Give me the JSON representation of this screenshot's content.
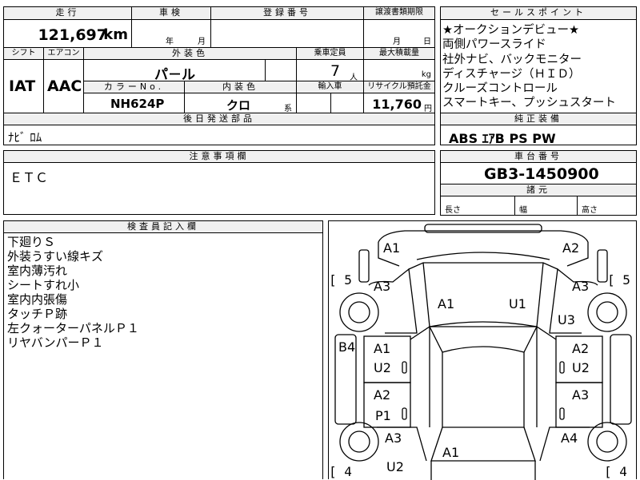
{
  "headers": {
    "mileage": "走行",
    "inspection": "車検",
    "registration_no": "登録番号",
    "transfer_deadline": "譲渡書類期限",
    "selling_points": "セールスポイント",
    "shift": "シフト",
    "aircon": "エアコン",
    "exterior_color": "外装色",
    "capacity": "乗車定員",
    "max_load": "最大積載量",
    "color_no": "カラーNo.",
    "interior_color": "内装色",
    "import": "輸入車",
    "recycle_fee": "リサイクル預託金",
    "later_parts": "後日発送部品",
    "standard_equipment": "純正装備",
    "notes": "注意事項欄",
    "chassis_no": "車台番号",
    "dimensions": "諸元",
    "inspector_notes": "検査員記入欄"
  },
  "mileage": {
    "value": "121,697",
    "unit": "km"
  },
  "inspection": {
    "year_unit": "年",
    "month_unit": "月"
  },
  "transfer_deadline": {
    "month_unit": "月",
    "day_unit": "日"
  },
  "selling_points": [
    "★オークションデビュー★",
    "両側パワースライド",
    "社外ナビ、バックモニター",
    "ディスチャージ（ＨＩＤ）",
    "クルーズコントロール",
    "スマートキー、プッシュスタート"
  ],
  "shift": "IAT",
  "aircon": "AAC",
  "exterior_color": "パ－ル",
  "capacity": {
    "value": "7",
    "unit": "人"
  },
  "max_load": {
    "unit": "kg"
  },
  "color_no": "NH624P",
  "interior_color": {
    "value": "クロ",
    "suffix": "系"
  },
  "recycle_fee": {
    "value": "11,760",
    "unit": "円"
  },
  "later_parts": "ﾅﾋﾞ ﾛﾑ",
  "standard_equipment": "ABS ｴｱB PS PW",
  "notes": "ＥＴＣ",
  "chassis_no": "GB3-1450900",
  "dimensions": {
    "length": "長さ",
    "width": "幅",
    "height": "高さ"
  },
  "inspector_notes": [
    "下廻りＳ",
    "外装うすい線キズ",
    "室内薄汚れ",
    "シートすれ小",
    "室内内張傷",
    "タッチＰ跡",
    "左クォーターパネルＰ１",
    "リヤバンパーＰ１"
  ],
  "diagram": {
    "tread_left_front": "[ 5",
    "tread_right_front": "[ 5",
    "tread_left_rear": "[ 4",
    "tread_right_rear": "[ 4",
    "labels": {
      "a1_front_left": "A1",
      "a2_front_right": "A2",
      "a3_left_fender": "A3",
      "a3_right_fender": "A3",
      "a1_hood": "A1",
      "u1_hood": "U1",
      "u3_right": "U3",
      "b4_left": "B4",
      "a1_left_front_door": "A1",
      "u2_left_front_door": "U2",
      "a2_right_front_door": "A2",
      "u2_right_front_door": "U2",
      "a2_left_rear_door": "A2",
      "p1_left_rear_door": "P1",
      "a3_right_rear_door": "A3",
      "a3_left_quarter": "A3",
      "a4_right_quarter": "A4",
      "a1_rear": "A1",
      "u2_rear": "U2"
    }
  }
}
